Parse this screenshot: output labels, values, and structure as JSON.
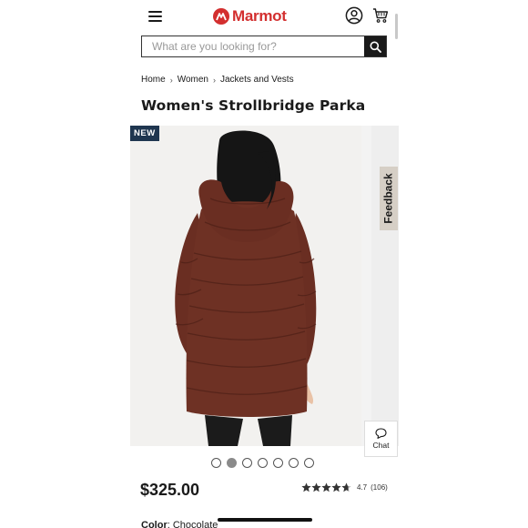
{
  "header": {
    "brand": "Marmot",
    "brand_color": "#d32f2f"
  },
  "search": {
    "placeholder": "What are you looking for?"
  },
  "breadcrumb": [
    "Home",
    "Women",
    "Jackets and Vests"
  ],
  "product": {
    "title": "Women's Strollbridge Parka",
    "badge": "NEW",
    "price": "$325.00",
    "rating": "4.7",
    "review_count": "(106)",
    "stars_filled": 4.7,
    "color_label": "Color",
    "color_value": "Chocolate"
  },
  "gallery": {
    "image_count": 7,
    "active_index": 1
  },
  "widgets": {
    "feedback_label": "Feedback",
    "chat_label": "Chat"
  },
  "colors": {
    "jacket": "#6e3124",
    "badge_bg": "#1f3650",
    "feedback_bg": "#d6cfc6"
  }
}
